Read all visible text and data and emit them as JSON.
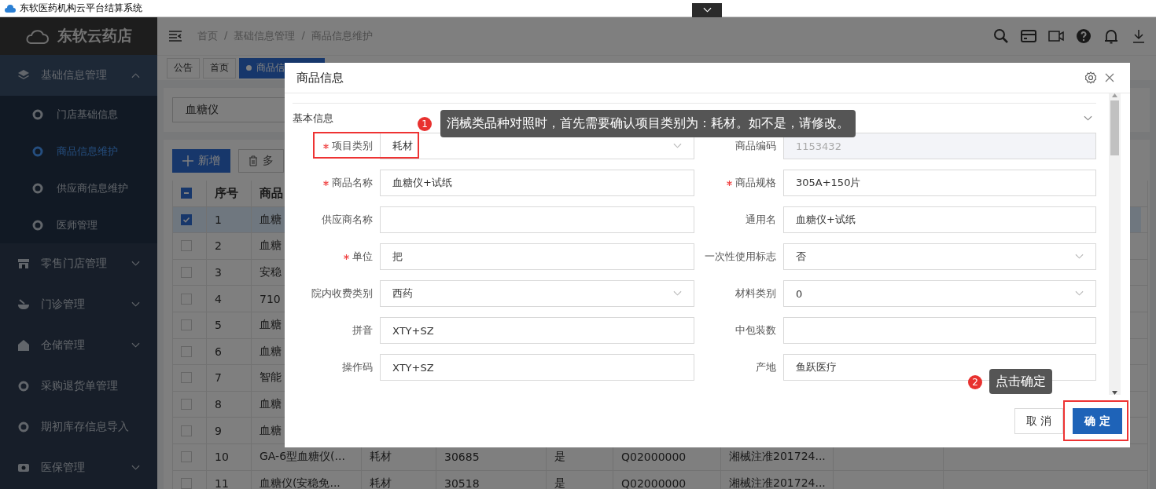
{
  "window": {
    "title": "东软医药机构云平台结算系统"
  },
  "sidebar": {
    "logo": "东软云药店",
    "items": [
      {
        "label": "基础信息管理",
        "expanded": true,
        "children": [
          {
            "label": "门店基础信息",
            "selected": false
          },
          {
            "label": "商品信息维护",
            "selected": true
          },
          {
            "label": "供应商信息维护",
            "selected": false
          },
          {
            "label": "医师管理",
            "selected": false
          }
        ]
      },
      {
        "label": "零售门店管理",
        "expanded": false
      },
      {
        "label": "门诊管理",
        "expanded": false
      },
      {
        "label": "仓储管理",
        "expanded": false
      },
      {
        "label": "采购退货单管理"
      },
      {
        "label": "期初库存信息导入"
      },
      {
        "label": "医保管理",
        "expanded": false
      }
    ]
  },
  "breadcrumb": [
    "首页",
    "/",
    "基础信息管理",
    "/",
    "商品信息维护"
  ],
  "tabs": [
    {
      "label": "公告",
      "selected": false
    },
    {
      "label": "首页",
      "selected": false
    },
    {
      "label": "商品信",
      "selected": true
    }
  ],
  "search": {
    "value": "血糖仪"
  },
  "toolbar": [
    {
      "label": "新增",
      "kind": "primary"
    },
    {
      "label": "多",
      "kind": "delete"
    }
  ],
  "table": {
    "header_checkbox": {
      "indeterminate": true
    },
    "columns": [
      "序号",
      "商品"
    ],
    "rows": [
      {
        "checked": true,
        "selected": true,
        "cells": [
          "1",
          "血糖"
        ]
      },
      {
        "checked": false,
        "selected": false,
        "cells": [
          "2",
          "血糖"
        ]
      },
      {
        "checked": false,
        "selected": false,
        "cells": [
          "3",
          "安稳"
        ]
      },
      {
        "checked": false,
        "selected": false,
        "cells": [
          "4",
          "710"
        ]
      },
      {
        "checked": false,
        "selected": false,
        "cells": [
          "5",
          "血糖"
        ]
      },
      {
        "checked": false,
        "selected": false,
        "cells": [
          "6",
          "血糖"
        ]
      },
      {
        "checked": false,
        "selected": false,
        "cells": [
          "7",
          "智能"
        ]
      },
      {
        "checked": false,
        "selected": false,
        "cells": [
          "8",
          "血糖"
        ]
      },
      {
        "checked": false,
        "selected": false,
        "cells": [
          "9",
          "血糖"
        ]
      },
      {
        "checked": false,
        "selected": false,
        "cells": [
          "10",
          "GA-6型血糖仪(...",
          "耗材",
          "30685",
          "是",
          "Q02000000",
          "湘械注准201724..."
        ]
      },
      {
        "checked": false,
        "selected": false,
        "cells": [
          "11",
          "血糖仪(安稳免...",
          "耗材",
          "30518",
          "是",
          "Q02000000",
          "湘械注准201724..."
        ]
      }
    ]
  },
  "dialog": {
    "title": "商品信息",
    "section": {
      "title": "基本信息",
      "expanded": true
    },
    "fields": [
      {
        "label": "项目类别",
        "required": true,
        "kind": "select",
        "value": "耗材",
        "highlighted": true
      },
      {
        "label": "商品编码",
        "required": false,
        "kind": "input",
        "value": "1153432",
        "disabled": true
      },
      {
        "label": "商品名称",
        "required": true,
        "kind": "input",
        "value": "血糖仪+试纸"
      },
      {
        "label": "商品规格",
        "required": true,
        "kind": "input",
        "value": "305A+150片"
      },
      {
        "label": "供应商名称",
        "required": false,
        "kind": "input"
      },
      {
        "label": "通用名",
        "required": false,
        "kind": "input",
        "value": "血糖仪+试纸"
      },
      {
        "label": "单位",
        "required": true,
        "kind": "input",
        "value": "把"
      },
      {
        "label": "一次性使用标志",
        "required": false,
        "kind": "select",
        "value": "否"
      },
      {
        "label": "院内收费类别",
        "required": false,
        "kind": "select",
        "value": "西药"
      },
      {
        "label": "材料类别",
        "required": false,
        "kind": "select",
        "value": "0"
      },
      {
        "label": "拼音",
        "required": false,
        "kind": "input",
        "value": "XTY+SZ"
      },
      {
        "label": "中包装数",
        "required": false,
        "kind": "input"
      },
      {
        "label": "操作码",
        "required": false,
        "kind": "input",
        "value": "XTY+SZ"
      },
      {
        "label": "产地",
        "required": false,
        "kind": "input",
        "value": "鱼跃医疗"
      }
    ],
    "buttons": [
      {
        "label": "取 消",
        "kind": "default",
        "highlighted": false
      },
      {
        "label": "确 定",
        "kind": "primary",
        "highlighted": true
      }
    ],
    "annotations": [
      {
        "number": "1",
        "text": "消械类品种对照时，首先需要确认项目类别为：耗材。如不是，请修改。"
      },
      {
        "number": "2",
        "text": "点击确定"
      }
    ]
  }
}
